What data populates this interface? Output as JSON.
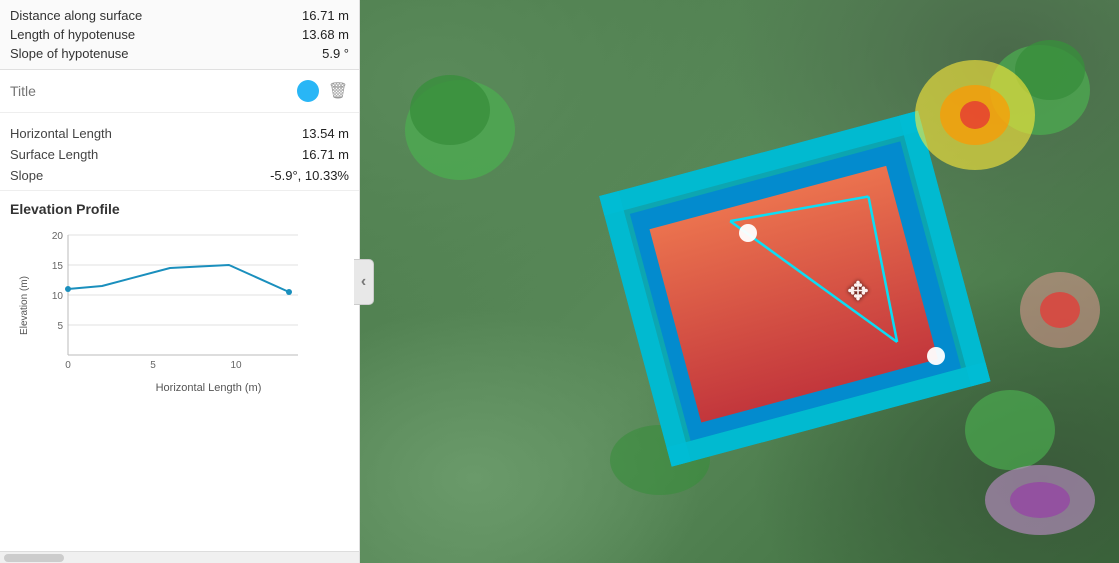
{
  "summary": {
    "rows": [
      {
        "label": "Distance along surface",
        "value": "16.71 m"
      },
      {
        "label": "Length of hypotenuse",
        "value": "13.68 m"
      },
      {
        "label": "Slope of hypotenuse",
        "value": "5.9 °"
      }
    ]
  },
  "title_input": {
    "placeholder": "Title"
  },
  "details": {
    "rows": [
      {
        "label": "Horizontal Length",
        "value": "13.54 m"
      },
      {
        "label": "Surface Length",
        "value": "16.71 m"
      },
      {
        "label": "Slope",
        "value": "-5.9°, 10.33%"
      }
    ]
  },
  "profile": {
    "title": "Elevation Profile",
    "y_axis_label": "Elevation (m)",
    "x_axis_label": "Horizontal Length (m)",
    "y_ticks": [
      "20",
      "15",
      "10",
      "5"
    ],
    "x_ticks": [
      "0",
      "5",
      "10"
    ],
    "colors": {
      "line": "#1a8fbd",
      "axis": "#999"
    }
  },
  "colors": {
    "color_dot": "#29b6f6",
    "trash": "#aaa"
  },
  "icons": {
    "trash": "🗑",
    "arrow_left": "‹",
    "move": "✥"
  }
}
